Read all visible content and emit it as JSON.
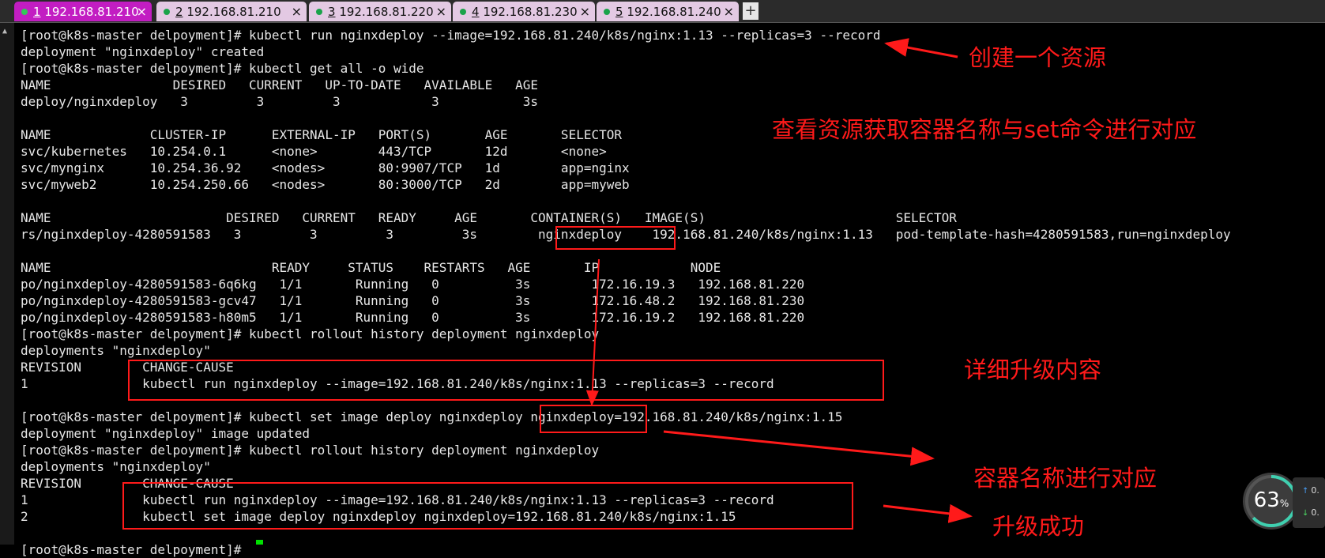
{
  "tabs": [
    {
      "num": "1",
      "host": "192.168.81.210",
      "active": true,
      "dot": "#34c759"
    },
    {
      "num": "2",
      "host": "192.168.81.210",
      "active": false,
      "dot": "#1aa34a"
    },
    {
      "num": "3",
      "host": "192.168.81.220",
      "active": false,
      "dot": "#1aa34a"
    },
    {
      "num": "4",
      "host": "192.168.81.230",
      "active": false,
      "dot": "#1aa34a"
    },
    {
      "num": "5",
      "host": "192.168.81.240",
      "active": false,
      "dot": "#1aa34a"
    }
  ],
  "tab_close_glyph": "×",
  "add_tab_glyph": "+",
  "terminal_lines": [
    "[root@k8s-master delpoyment]# kubectl run nginxdeploy --image=192.168.81.240/k8s/nginx:1.13 --replicas=3 --record",
    "deployment \"nginxdeploy\" created",
    "[root@k8s-master delpoyment]# kubectl get all -o wide",
    "NAME                DESIRED   CURRENT   UP-TO-DATE   AVAILABLE   AGE",
    "deploy/nginxdeploy   3         3         3            3           3s",
    "",
    "NAME             CLUSTER-IP      EXTERNAL-IP   PORT(S)       AGE       SELECTOR",
    "svc/kubernetes   10.254.0.1      <none>        443/TCP       12d       <none>",
    "svc/mynginx      10.254.36.92    <nodes>       80:9907/TCP   1d        app=nginx",
    "svc/myweb2       10.254.250.66   <nodes>       80:3000/TCP   2d        app=myweb",
    "",
    "NAME                       DESIRED   CURRENT   READY     AGE       CONTAINER(S)   IMAGE(S)                         SELECTOR",
    "rs/nginxdeploy-4280591583   3         3         3         3s        nginxdeploy    192.168.81.240/k8s/nginx:1.13   pod-template-hash=4280591583,run=nginxdeploy",
    "",
    "NAME                             READY     STATUS    RESTARTS   AGE       IP            NODE",
    "po/nginxdeploy-4280591583-6q6kg   1/1       Running   0          3s        172.16.19.3   192.168.81.220",
    "po/nginxdeploy-4280591583-gcv47   1/1       Running   0          3s        172.16.48.2   192.168.81.230",
    "po/nginxdeploy-4280591583-h80m5   1/1       Running   0          3s        172.16.19.2   192.168.81.220",
    "[root@k8s-master delpoyment]# kubectl rollout history deployment nginxdeploy",
    "deployments \"nginxdeploy\"",
    "REVISION        CHANGE-CAUSE",
    "1               kubectl run nginxdeploy --image=192.168.81.240/k8s/nginx:1.13 --replicas=3 --record",
    "",
    "[root@k8s-master delpoyment]# kubectl set image deploy nginxdeploy nginxdeploy=192.168.81.240/k8s/nginx:1.15",
    "deployment \"nginxdeploy\" image updated",
    "[root@k8s-master delpoyment]# kubectl rollout history deployment nginxdeploy",
    "deployments \"nginxdeploy\"",
    "REVISION        CHANGE-CAUSE",
    "1               kubectl run nginxdeploy --image=192.168.81.240/k8s/nginx:1.13 --replicas=3 --record",
    "2               kubectl set image deploy nginxdeploy nginxdeploy=192.168.81.240/k8s/nginx:1.15",
    "",
    "[root@k8s-master delpoyment]# "
  ],
  "annotations": {
    "create": "创建一个资源",
    "view": "查看资源获取容器名称与set命令进行对应",
    "detail": "详细升级内容",
    "match": "容器名称进行对应",
    "success": "升级成功"
  },
  "gauge": {
    "value": "63",
    "unit": "%",
    "level": 0.63
  },
  "net": {
    "up": "0.",
    "down": "0."
  },
  "colors": {
    "annotation": "#ff1a1a",
    "active_tab": "#c21dc2",
    "inactive_tab": "#e3c9e3",
    "cursor": "#00e000",
    "terminal_bg": "#000000",
    "terminal_fg": "#e6e6e6"
  }
}
